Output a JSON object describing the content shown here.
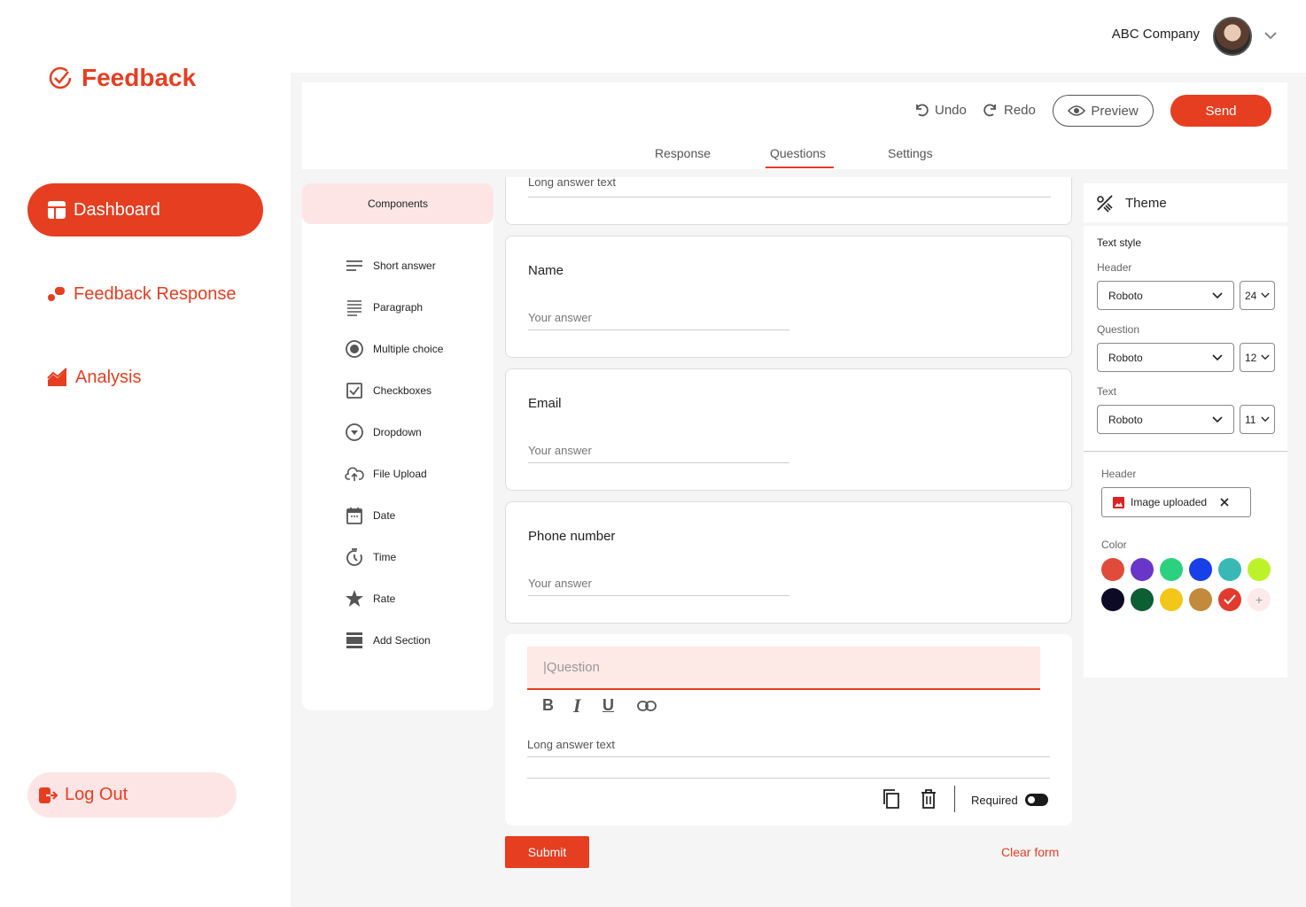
{
  "brand": {
    "name": "Feedback",
    "accent": "#e63e21"
  },
  "nav": {
    "items": [
      {
        "label": "Dashboard"
      },
      {
        "label": "Feedback Response"
      },
      {
        "label": "Analysis"
      }
    ],
    "logout": "Log Out"
  },
  "header": {
    "company": "ABC Company"
  },
  "toolbar": {
    "undo": "Undo",
    "redo": "Redo",
    "preview": "Preview",
    "send": "Send",
    "tabs": [
      {
        "label": "Response"
      },
      {
        "label": "Questions"
      },
      {
        "label": "Settings"
      }
    ],
    "active_tab": "Questions"
  },
  "components": {
    "title": "Components",
    "items": [
      {
        "label": "Short answer",
        "icon": "short-answer-icon"
      },
      {
        "label": "Paragraph",
        "icon": "paragraph-icon"
      },
      {
        "label": "Multiple choice",
        "icon": "radio-icon"
      },
      {
        "label": "Checkboxes",
        "icon": "checkbox-icon"
      },
      {
        "label": "Dropdown",
        "icon": "dropdown-icon"
      },
      {
        "label": "File Upload",
        "icon": "cloud-upload-icon"
      },
      {
        "label": "Date",
        "icon": "calendar-icon"
      },
      {
        "label": "Time",
        "icon": "timer-icon"
      },
      {
        "label": "Rate",
        "icon": "star-icon"
      },
      {
        "label": "Add Section",
        "icon": "section-icon"
      }
    ]
  },
  "form": {
    "partial_card": {
      "answer": "Long answer text"
    },
    "questions": [
      {
        "title": "Name",
        "placeholder": "Your answer"
      },
      {
        "title": "Email",
        "placeholder": "Your answer"
      },
      {
        "title": "Phone number",
        "placeholder": "Your answer"
      }
    ],
    "editor": {
      "question_placeholder": "|Question",
      "bold": "B",
      "italic": "I",
      "underline": "U",
      "answer": "Long answer text",
      "required_label": "Required",
      "required": false
    },
    "submit": "Submit",
    "clear": "Clear form"
  },
  "theme": {
    "title": "Theme",
    "text_style": "Text style",
    "header": {
      "label": "Header",
      "font": "Roboto",
      "size": "24"
    },
    "question": {
      "label": "Question",
      "font": "Roboto",
      "size": "12"
    },
    "text": {
      "label": "Text",
      "font": "Roboto",
      "size": "11"
    },
    "header_image": {
      "label": "Header",
      "value": "Image uploaded"
    },
    "color": {
      "label": "Color",
      "swatches": [
        "#e04b3a",
        "#6a35c9",
        "#2bd17e",
        "#1740e8",
        "#38b9b6",
        "#bdf22a",
        "#0d0a26",
        "#0e5e33",
        "#f2c71a",
        "#c28a3a",
        "#e23b2e"
      ],
      "selected": "#e23b2e",
      "add": "+"
    }
  }
}
